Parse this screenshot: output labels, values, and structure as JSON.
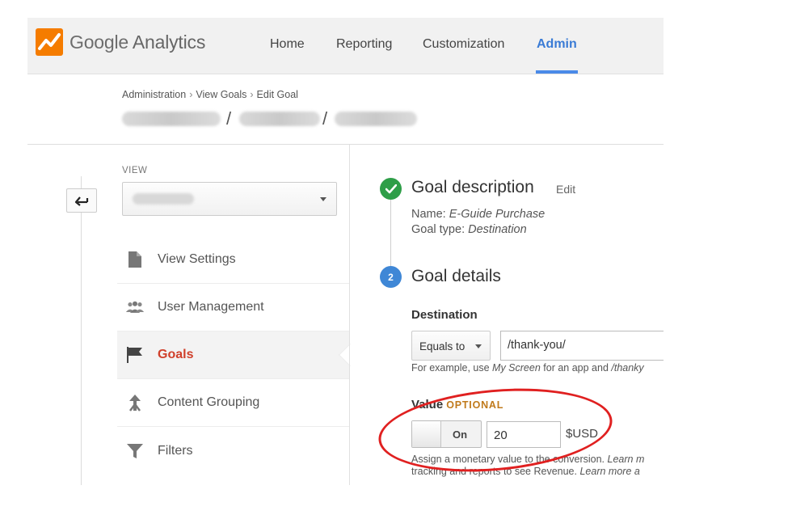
{
  "app": {
    "logo_word1": "Google",
    "logo_word2": "Analytics"
  },
  "nav": {
    "items": [
      {
        "label": "Home"
      },
      {
        "label": "Reporting"
      },
      {
        "label": "Customization"
      },
      {
        "label": "Admin",
        "active": true
      }
    ],
    "active_color": "#3a7bd5"
  },
  "breadcrumb": {
    "items": [
      "Administration",
      "View Goals",
      "Edit Goal"
    ],
    "separator": "›",
    "path_separator": "/"
  },
  "sidebar": {
    "view_label": "VIEW",
    "menu": [
      {
        "label": "View Settings",
        "icon": "document-icon"
      },
      {
        "label": "User Management",
        "icon": "users-icon"
      },
      {
        "label": "Goals",
        "icon": "flag-icon",
        "active": true
      },
      {
        "label": "Content Grouping",
        "icon": "grouping-icon"
      },
      {
        "label": "Filters",
        "icon": "filter-icon"
      }
    ]
  },
  "goal": {
    "step1_title": "Goal description",
    "step1_edit": "Edit",
    "name_prefix": "Name: ",
    "name_value": "E-Guide Purchase",
    "type_prefix": "Goal type: ",
    "type_value": "Destination",
    "step2_number": "2",
    "step2_title": "Goal details",
    "destination_label": "Destination",
    "match_type": "Equals to",
    "destination_value": "/thank-you/",
    "dest_help_a": "For example, use ",
    "dest_help_b": "My Screen",
    "dest_help_c": " for an app and ",
    "dest_help_d": "/thanky",
    "value_label": "Value",
    "value_optional": "OPTIONAL",
    "toggle_label": "On",
    "value_amount": "20",
    "currency": "$USD",
    "value_help_line1_a": "Assign a monetary value to the conversion. ",
    "value_help_line1_b": "Learn m",
    "value_help_line2_a": "tracking and reports to see Revenue. ",
    "value_help_line2_b": "Learn more a"
  },
  "colors": {
    "success": "#2e9e48",
    "step": "#3f87d6",
    "active_menu": "#d0402b",
    "highlight": "#e02020"
  }
}
